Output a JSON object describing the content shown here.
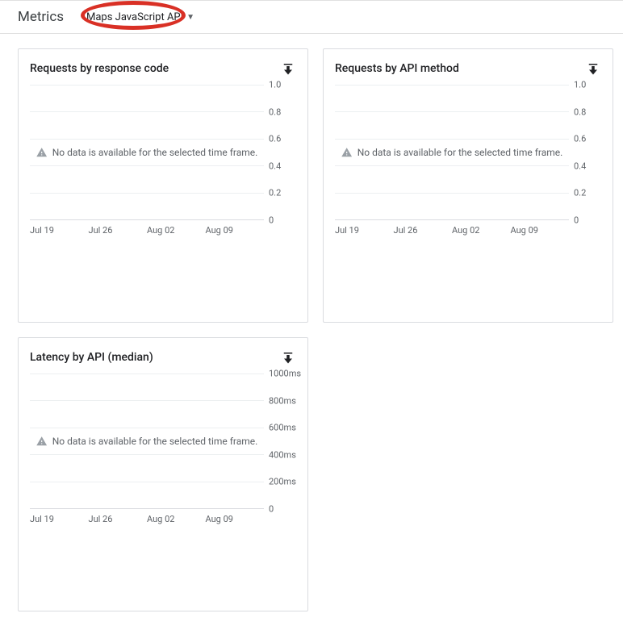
{
  "header": {
    "title": "Metrics",
    "dropdown_label": "Maps JavaScript API"
  },
  "charts": [
    {
      "title": "Requests by response code",
      "nodata_msg": "No data is available for the selected time frame.",
      "yticks": [
        "1.0",
        "0.8",
        "0.6",
        "0.4",
        "0.2",
        "0"
      ],
      "xticks": [
        "Jul 19",
        "Jul 26",
        "Aug 02",
        "Aug 09"
      ]
    },
    {
      "title": "Requests by API method",
      "nodata_msg": "No data is available for the selected time frame.",
      "yticks": [
        "1.0",
        "0.8",
        "0.6",
        "0.4",
        "0.2",
        "0"
      ],
      "xticks": [
        "Jul 19",
        "Jul 26",
        "Aug 02",
        "Aug 09"
      ]
    },
    {
      "title": "Latency by API (median)",
      "nodata_msg": "No data is available for the selected time frame.",
      "yticks": [
        "1000ms",
        "800ms",
        "600ms",
        "400ms",
        "200ms",
        "0"
      ],
      "xticks": [
        "Jul 19",
        "Jul 26",
        "Aug 02",
        "Aug 09"
      ]
    }
  ],
  "chart_data": [
    {
      "type": "line",
      "title": "Requests by response code",
      "categories": [
        "Jul 19",
        "Jul 26",
        "Aug 02",
        "Aug 09"
      ],
      "series": [],
      "ylim": [
        0,
        1.0
      ],
      "ylabel": "",
      "xlabel": "",
      "note": "No data"
    },
    {
      "type": "line",
      "title": "Requests by API method",
      "categories": [
        "Jul 19",
        "Jul 26",
        "Aug 02",
        "Aug 09"
      ],
      "series": [],
      "ylim": [
        0,
        1.0
      ],
      "ylabel": "",
      "xlabel": "",
      "note": "No data"
    },
    {
      "type": "line",
      "title": "Latency by API (median)",
      "categories": [
        "Jul 19",
        "Jul 26",
        "Aug 02",
        "Aug 09"
      ],
      "series": [],
      "ylim": [
        0,
        1000
      ],
      "ylabel": "ms",
      "xlabel": "",
      "note": "No data"
    }
  ]
}
